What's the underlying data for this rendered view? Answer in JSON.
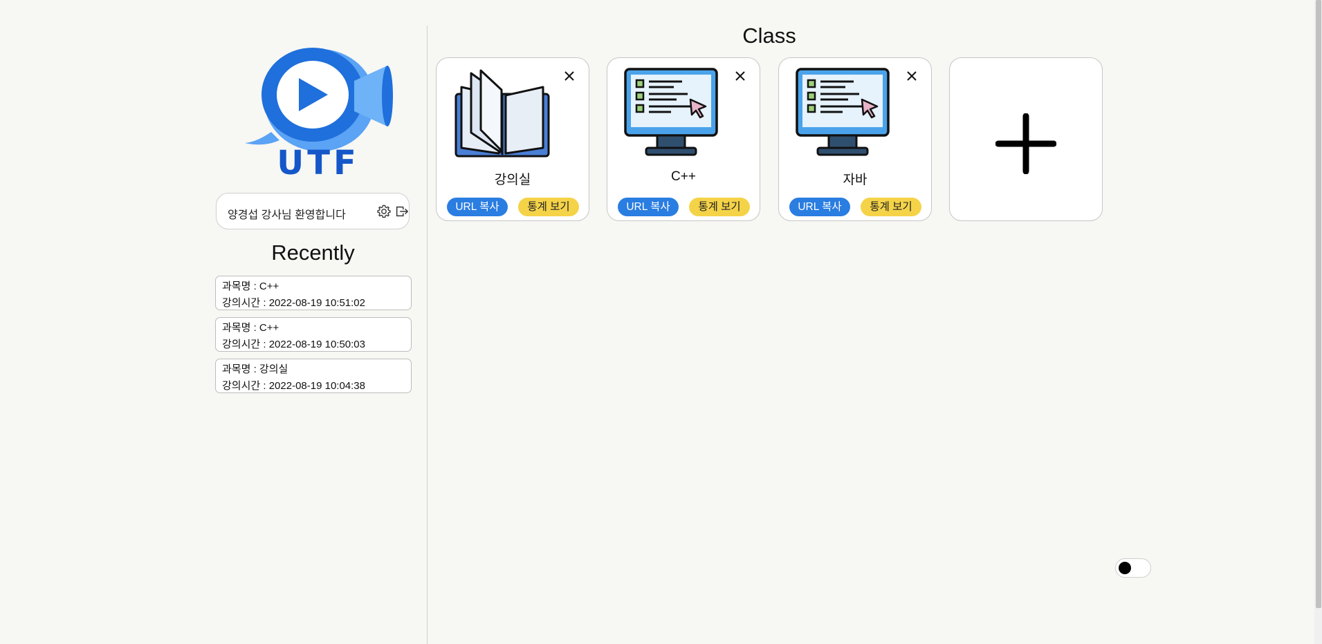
{
  "sidebar": {
    "logo_text": "UTF",
    "welcome_text": "양경섭 강사님 환영합니다",
    "recently_title": "Recently",
    "recent": [
      {
        "subject": "과목명 : C++",
        "time": "강의시간 : 2022-08-19 10:51:02"
      },
      {
        "subject": "과목명 : C++",
        "time": "강의시간 : 2022-08-19 10:50:03"
      },
      {
        "subject": "과목명 : 강의실",
        "time": "강의시간 : 2022-08-19 10:04:38"
      }
    ]
  },
  "main": {
    "title": "Class",
    "cards": [
      {
        "name": "강의실",
        "icon": "book-icon",
        "url_label": "URL 복사",
        "stat_label": "통계 보기"
      },
      {
        "name": "C++",
        "icon": "computer-icon",
        "url_label": "URL 복사",
        "stat_label": "통계 보기"
      },
      {
        "name": "자바",
        "icon": "computer-icon",
        "url_label": "URL 복사",
        "stat_label": "통계 보기"
      }
    ],
    "add_card_icon": "plus-icon"
  },
  "colors": {
    "url_button": "#2a7de1",
    "stat_button": "#f5d348",
    "logo_blue": "#1557c9",
    "background": "#f7f7f3"
  },
  "toggle": {
    "state": "off"
  }
}
